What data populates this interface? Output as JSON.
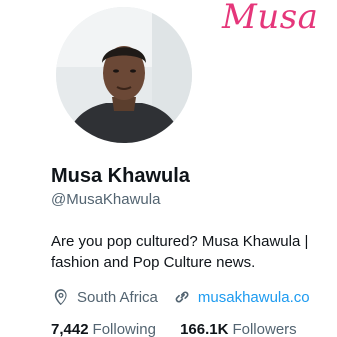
{
  "banner": {
    "text": "Musa"
  },
  "profile": {
    "name": "Musa Khawula",
    "handle": "@MusaKhawula",
    "bio_lines": [
      "Are you pop cultured? Musa Khawula |",
      "fashion and Pop Culture news."
    ],
    "location": "South Africa",
    "website": "musakhawula.co",
    "following_count": "7,442",
    "following_label": "Following",
    "followers_count": "166.1K",
    "followers_label": "Followers"
  },
  "icons": {
    "location": "location-pin-icon",
    "link": "link-icon"
  },
  "colors": {
    "banner_text": "#e5367a",
    "link": "#1d9bf0",
    "secondary_text": "#536471",
    "primary_text": "#0f1419"
  }
}
